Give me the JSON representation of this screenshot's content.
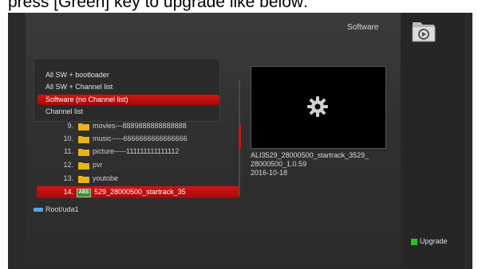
{
  "caption": "press [Green] key to upgrade like below:",
  "header": {
    "title": "Software"
  },
  "context_menu": {
    "items": [
      {
        "label": "All SW + bootloader",
        "selected": false
      },
      {
        "label": "All SW + Channel list",
        "selected": false
      },
      {
        "label": "Software (no Channel list)",
        "selected": true
      },
      {
        "label": "Channel list",
        "selected": false
      }
    ]
  },
  "file_list": {
    "items": [
      {
        "num": "9.",
        "name": "movies---8889888888888888",
        "type": "folder",
        "selected": false
      },
      {
        "num": "10.",
        "name": "music-----6666666666666666",
        "type": "folder",
        "selected": false
      },
      {
        "num": "11.",
        "name": "picture-----111111111111112",
        "type": "folder",
        "selected": false
      },
      {
        "num": "12.",
        "name": "pvr",
        "type": "folder",
        "selected": false
      },
      {
        "num": "13.",
        "name": "youtobe",
        "type": "folder",
        "selected": false
      },
      {
        "num": "14.",
        "name": "529_28000500_startrack_35",
        "type": "abs-file",
        "badge": "ABS",
        "selected": true
      }
    ]
  },
  "info": {
    "line1": "ALI3529_28000500_startrack_3529_",
    "line2": "28000500_1.0.59",
    "line3": "2016-10-18"
  },
  "path": {
    "label": "Root/uda1"
  },
  "footer": {
    "upgrade_label": "Upgrade"
  },
  "colors": {
    "highlight": "#c81414",
    "folder": "#e8b418",
    "green_key": "#29c21f",
    "drive": "#5aa6e0"
  }
}
